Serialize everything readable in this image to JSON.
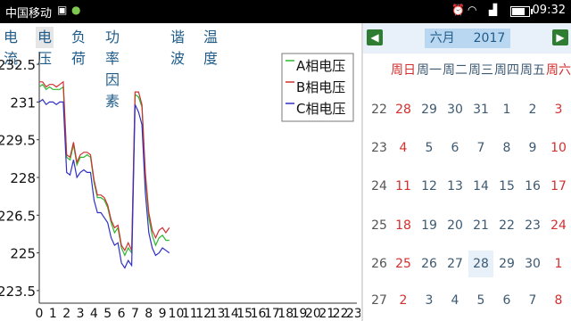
{
  "statusbar": {
    "carrier": "中国移动",
    "time": "09:32"
  },
  "tabs": [
    "电流",
    "电压",
    "负荷",
    "功率因素",
    "谐波",
    "温度"
  ],
  "active_tab": "电压",
  "colors": {
    "A": "#2eb82e",
    "B": "#d03030",
    "C": "#3030c8"
  },
  "chart_data": {
    "type": "line",
    "title": "",
    "xlabel": "",
    "ylabel": "",
    "ylim": [
      223.0,
      233.0
    ],
    "yticks": [
      "232.5",
      "231",
      "229.5",
      "228",
      "226.5",
      "225",
      "223.5"
    ],
    "ytick_values": [
      232.5,
      231,
      229.5,
      228,
      226.5,
      225,
      223.5
    ],
    "xticks": [
      "0",
      "1",
      "2",
      "3",
      "4",
      "5",
      "6",
      "7",
      "8",
      "9",
      "10",
      "11",
      "12",
      "13",
      "14",
      "15",
      "16",
      "17",
      "18",
      "19",
      "20",
      "21",
      "22",
      "23"
    ],
    "xlim": [
      0,
      23.2
    ],
    "legend": "top-right",
    "series": [
      {
        "name": "A相电压",
        "color": "#2eb82e",
        "x": [
          0,
          0.25,
          0.5,
          0.75,
          1,
          1.25,
          1.5,
          1.75,
          2,
          2.25,
          2.5,
          2.75,
          3,
          3.25,
          3.5,
          3.75,
          4,
          4.25,
          4.5,
          4.75,
          5,
          5.25,
          5.5,
          5.75,
          6,
          6.25,
          6.5,
          6.75,
          7,
          7.25,
          7.5,
          7.75,
          8,
          8.25,
          8.5,
          8.75,
          9,
          9.25,
          9.5
        ],
        "y": [
          231.6,
          231.7,
          231.5,
          231.6,
          231.5,
          231.5,
          231.5,
          231.6,
          228.8,
          228.7,
          229.3,
          228.5,
          228.8,
          228.8,
          228.9,
          228.8,
          227.8,
          227.2,
          227.2,
          227.1,
          226.8,
          226.2,
          225.8,
          226.0,
          225.2,
          224.9,
          225.2,
          225.0,
          231.3,
          231.2,
          230.8,
          228.0,
          226.4,
          225.7,
          225.3,
          225.6,
          225.7,
          225.5,
          225.5
        ]
      },
      {
        "name": "B相电压",
        "color": "#d03030",
        "x": [
          0,
          0.25,
          0.5,
          0.75,
          1,
          1.25,
          1.5,
          1.75,
          2,
          2.25,
          2.5,
          2.75,
          3,
          3.25,
          3.5,
          3.75,
          4,
          4.25,
          4.5,
          4.75,
          5,
          5.25,
          5.5,
          5.75,
          6,
          6.25,
          6.5,
          6.75,
          7,
          7.25,
          7.5,
          7.75,
          8,
          8.25,
          8.5,
          8.75,
          9,
          9.25,
          9.5
        ],
        "y": [
          231.8,
          231.8,
          231.6,
          231.7,
          231.7,
          231.6,
          231.7,
          231.8,
          228.9,
          228.8,
          229.4,
          228.6,
          228.9,
          229.0,
          229.0,
          228.9,
          227.9,
          227.3,
          227.3,
          227.2,
          226.9,
          226.3,
          226.0,
          226.1,
          225.3,
          225.1,
          225.4,
          225.1,
          231.4,
          231.4,
          230.9,
          228.2,
          226.6,
          225.9,
          225.6,
          225.9,
          226.0,
          225.8,
          226.0
        ]
      },
      {
        "name": "C相电压",
        "color": "#3030c8",
        "x": [
          0,
          0.25,
          0.5,
          0.75,
          1,
          1.25,
          1.5,
          1.75,
          2,
          2.25,
          2.5,
          2.75,
          3,
          3.25,
          3.5,
          3.75,
          4,
          4.25,
          4.5,
          4.75,
          5,
          5.25,
          5.5,
          5.75,
          6,
          6.25,
          6.5,
          6.75,
          7,
          7.25,
          7.5,
          7.75,
          8,
          8.25,
          8.5,
          8.75,
          9,
          9.25,
          9.5
        ],
        "y": [
          231.0,
          231.1,
          230.9,
          231.0,
          231.0,
          230.9,
          231.0,
          231.0,
          228.2,
          228.1,
          228.7,
          228.0,
          228.2,
          228.3,
          228.2,
          228.2,
          227.1,
          226.6,
          226.6,
          226.4,
          226.2,
          225.6,
          225.3,
          225.4,
          224.6,
          224.4,
          224.7,
          224.5,
          230.9,
          230.6,
          230.1,
          227.4,
          225.8,
          225.2,
          224.9,
          225.0,
          225.2,
          225.1,
          225.0
        ]
      }
    ]
  },
  "calendar": {
    "prev": "◀",
    "next": "▶",
    "month": "六月",
    "year": "2017",
    "weekdays": [
      "周日",
      "周一",
      "周二",
      "周三",
      "周四",
      "周五",
      "周六"
    ],
    "rows": [
      {
        "week": "22",
        "days": [
          "28",
          "29",
          "30",
          "31",
          "1",
          "2",
          "3"
        ]
      },
      {
        "week": "23",
        "days": [
          "4",
          "5",
          "6",
          "7",
          "8",
          "9",
          "10"
        ]
      },
      {
        "week": "24",
        "days": [
          "11",
          "12",
          "13",
          "14",
          "15",
          "16",
          "17"
        ]
      },
      {
        "week": "25",
        "days": [
          "18",
          "19",
          "20",
          "21",
          "22",
          "23",
          "24"
        ]
      },
      {
        "week": "26",
        "days": [
          "25",
          "26",
          "27",
          "28",
          "29",
          "30",
          "1"
        ]
      },
      {
        "week": "27",
        "days": [
          "2",
          "3",
          "4",
          "5",
          "6",
          "7",
          "8"
        ]
      }
    ]
  }
}
